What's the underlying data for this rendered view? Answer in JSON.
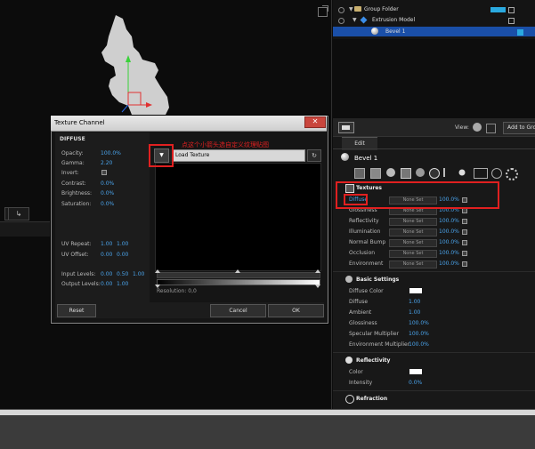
{
  "outline": {
    "rows": [
      {
        "label": "Group Folder"
      },
      {
        "label": "Extrusion Model"
      },
      {
        "label": "Bevel 1"
      }
    ]
  },
  "material_panel": {
    "view_label": "View:",
    "add_to_group": "Add to Grou",
    "edit_tab": "Edit",
    "material_name": "Bevel 1",
    "textures": {
      "heading": "Textures",
      "rows": [
        {
          "label": "Diffuse",
          "value": "None Set",
          "percent": "100.0%"
        },
        {
          "label": "Glossiness",
          "value": "None Set",
          "percent": "100.0%"
        },
        {
          "label": "Reflectivity",
          "value": "None Set",
          "percent": "100.0%"
        },
        {
          "label": "Illumination",
          "value": "None Set",
          "percent": "100.0%"
        },
        {
          "label": "Normal Bump",
          "value": "None Set",
          "percent": "100.0%"
        },
        {
          "label": "Occlusion",
          "value": "None Set",
          "percent": "100.0%"
        },
        {
          "label": "Environment",
          "value": "None Set",
          "percent": "100.0%"
        }
      ]
    },
    "basic_settings": {
      "heading": "Basic Settings",
      "rows": [
        {
          "label": "Diffuse Color",
          "value": ""
        },
        {
          "label": "Diffuse",
          "value": "1.00"
        },
        {
          "label": "Ambient",
          "value": "1.00"
        },
        {
          "label": "Glossiness",
          "value": "100.0%"
        },
        {
          "label": "Specular Multiplier",
          "value": "100.0%"
        },
        {
          "label": "Environment Multiplier",
          "value": "100.0%"
        }
      ]
    },
    "reflectivity": {
      "heading": "Reflectivity",
      "rows": [
        {
          "label": "Color",
          "value": ""
        },
        {
          "label": "Intensity",
          "value": "0.0%"
        }
      ]
    },
    "refraction": {
      "heading": "Refraction"
    }
  },
  "dialog": {
    "title": "Texture Channel",
    "close": "✕",
    "section": "DIFFUSE",
    "fields": [
      {
        "label": "Opacity:",
        "value": "100.0%"
      },
      {
        "label": "Gamma:",
        "value": "2.20"
      },
      {
        "label": "Invert:",
        "value": ""
      },
      {
        "label": "Contrast:",
        "value": "0.0%"
      },
      {
        "label": "Brightness:",
        "value": "0.0%"
      },
      {
        "label": "Saturation:",
        "value": "0.0%"
      }
    ],
    "uv_repeat": {
      "label": "UV Repeat:",
      "a": "1.00",
      "b": "1.00"
    },
    "uv_offset": {
      "label": "UV Offset:",
      "a": "0.00",
      "b": "0.00"
    },
    "input_levels": {
      "label": "Input Levels:",
      "a": "0.00",
      "b": "0.50",
      "c": "1.00"
    },
    "output_levels": {
      "label": "Output Levels:",
      "a": "0.00",
      "b": "1.00"
    },
    "load_texture": "Load Texture",
    "dropdown_glyph": "▼",
    "refresh_glyph": "↻",
    "resolution": "Resolution: 0,0",
    "reset": "Reset",
    "cancel": "Cancel",
    "ok": "OK"
  },
  "annotation": "点这个小箭头选自定义纹理贴图",
  "colors": {
    "accent": "#4aa3ea",
    "selection": "#1a4fa8",
    "annotation": "#e02020"
  }
}
